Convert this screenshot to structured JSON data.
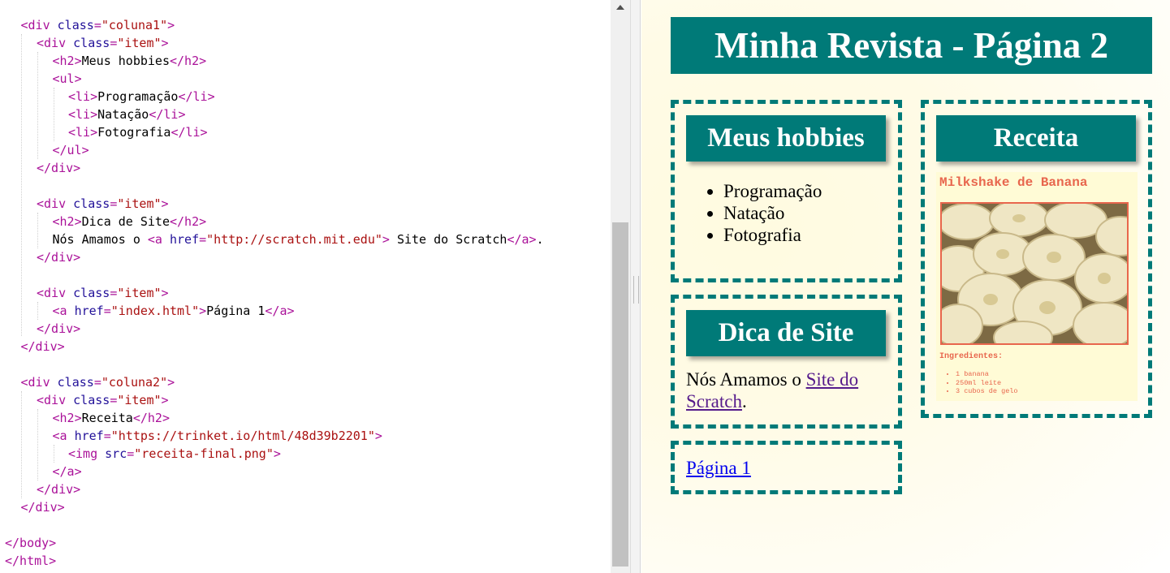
{
  "editor": {
    "lines": [
      [
        [
          "t",
          "<div "
        ],
        [
          "a",
          "class"
        ],
        [
          "t",
          "="
        ],
        [
          "s",
          "\"coluna1\""
        ],
        [
          "t",
          ">"
        ]
      ],
      [
        [
          "t",
          "<div "
        ],
        [
          "a",
          "class"
        ],
        [
          "t",
          "="
        ],
        [
          "s",
          "\"item\""
        ],
        [
          "t",
          ">"
        ]
      ],
      [
        [
          "t",
          "<h2>"
        ],
        [
          "tx",
          "Meus hobbies"
        ],
        [
          "t",
          "</h2>"
        ]
      ],
      [
        [
          "t",
          "<ul>"
        ]
      ],
      [
        [
          "t",
          "<li>"
        ],
        [
          "tx",
          "Programação"
        ],
        [
          "t",
          "</li>"
        ]
      ],
      [
        [
          "t",
          "<li>"
        ],
        [
          "tx",
          "Natação"
        ],
        [
          "t",
          "</li>"
        ]
      ],
      [
        [
          "t",
          "<li>"
        ],
        [
          "tx",
          "Fotografia"
        ],
        [
          "t",
          "</li>"
        ]
      ],
      [
        [
          "t",
          "</ul>"
        ]
      ],
      [
        [
          "t",
          "</div>"
        ]
      ],
      [],
      [
        [
          "t",
          "<div "
        ],
        [
          "a",
          "class"
        ],
        [
          "t",
          "="
        ],
        [
          "s",
          "\"item\""
        ],
        [
          "t",
          ">"
        ]
      ],
      [
        [
          "t",
          "<h2>"
        ],
        [
          "tx",
          "Dica de Site"
        ],
        [
          "t",
          "</h2>"
        ]
      ],
      [
        [
          "tx",
          "Nós Amamos o "
        ],
        [
          "t",
          "<a "
        ],
        [
          "a",
          "href"
        ],
        [
          "t",
          "="
        ],
        [
          "s",
          "\"http://scratch.mit.edu\""
        ],
        [
          "t",
          ">"
        ],
        [
          "tx",
          " Site do Scratch"
        ],
        [
          "t",
          "</a>"
        ],
        [
          "tx",
          "."
        ]
      ],
      [
        [
          "t",
          "</div>"
        ]
      ],
      [],
      [
        [
          "t",
          "<div "
        ],
        [
          "a",
          "class"
        ],
        [
          "t",
          "="
        ],
        [
          "s",
          "\"item\""
        ],
        [
          "t",
          ">"
        ]
      ],
      [
        [
          "t",
          "<a "
        ],
        [
          "a",
          "href"
        ],
        [
          "t",
          "="
        ],
        [
          "s",
          "\"index.html\""
        ],
        [
          "t",
          ">"
        ],
        [
          "tx",
          "Página 1"
        ],
        [
          "t",
          "</a>"
        ]
      ],
      [
        [
          "t",
          "</div>"
        ]
      ],
      [
        [
          "t",
          "</div>"
        ]
      ],
      [],
      [
        [
          "t",
          "<div "
        ],
        [
          "a",
          "class"
        ],
        [
          "t",
          "="
        ],
        [
          "s",
          "\"coluna2\""
        ],
        [
          "t",
          ">"
        ]
      ],
      [
        [
          "t",
          "<div "
        ],
        [
          "a",
          "class"
        ],
        [
          "t",
          "="
        ],
        [
          "s",
          "\"item\""
        ],
        [
          "t",
          ">"
        ]
      ],
      [
        [
          "t",
          "<h2>"
        ],
        [
          "tx",
          "Receita"
        ],
        [
          "t",
          "</h2>"
        ]
      ],
      [
        [
          "t",
          "<a "
        ],
        [
          "a",
          "href"
        ],
        [
          "t",
          "="
        ],
        [
          "s",
          "\"https://trinket.io/html/48d39b2201\""
        ],
        [
          "t",
          ">"
        ]
      ],
      [
        [
          "t",
          "<img "
        ],
        [
          "a",
          "src"
        ],
        [
          "t",
          "="
        ],
        [
          "s",
          "\"receita-final.png\""
        ],
        [
          "t",
          ">"
        ]
      ],
      [
        [
          "t",
          "</a>"
        ]
      ],
      [
        [
          "t",
          "</div>"
        ]
      ],
      [
        [
          "t",
          "</div>"
        ]
      ],
      [],
      [
        [
          "t",
          "</body>"
        ]
      ],
      [
        [
          "t",
          "</html>"
        ]
      ]
    ]
  },
  "preview": {
    "title": "Minha Revista - Página 2",
    "hobbies": {
      "heading": "Meus hobbies",
      "items": [
        "Programação",
        "Natação",
        "Fotografia"
      ]
    },
    "dica": {
      "heading": "Dica de Site",
      "text_before": "Nós Amamos o ",
      "link_text": "Site do Scratch",
      "text_after": "."
    },
    "pagina": {
      "link_text": "Página 1"
    },
    "receita": {
      "heading": "Receita",
      "card_title": "Milkshake de Banana",
      "ingredients_label": "Ingredientes:",
      "ingredients": [
        "1 banana",
        "250ml leite",
        "3 cubos de gelo"
      ]
    }
  },
  "colors": {
    "teal": "#007a78",
    "tag": "#aa1199",
    "attr": "#221199",
    "string": "#aa1111",
    "recipe_accent": "#e8664d"
  }
}
